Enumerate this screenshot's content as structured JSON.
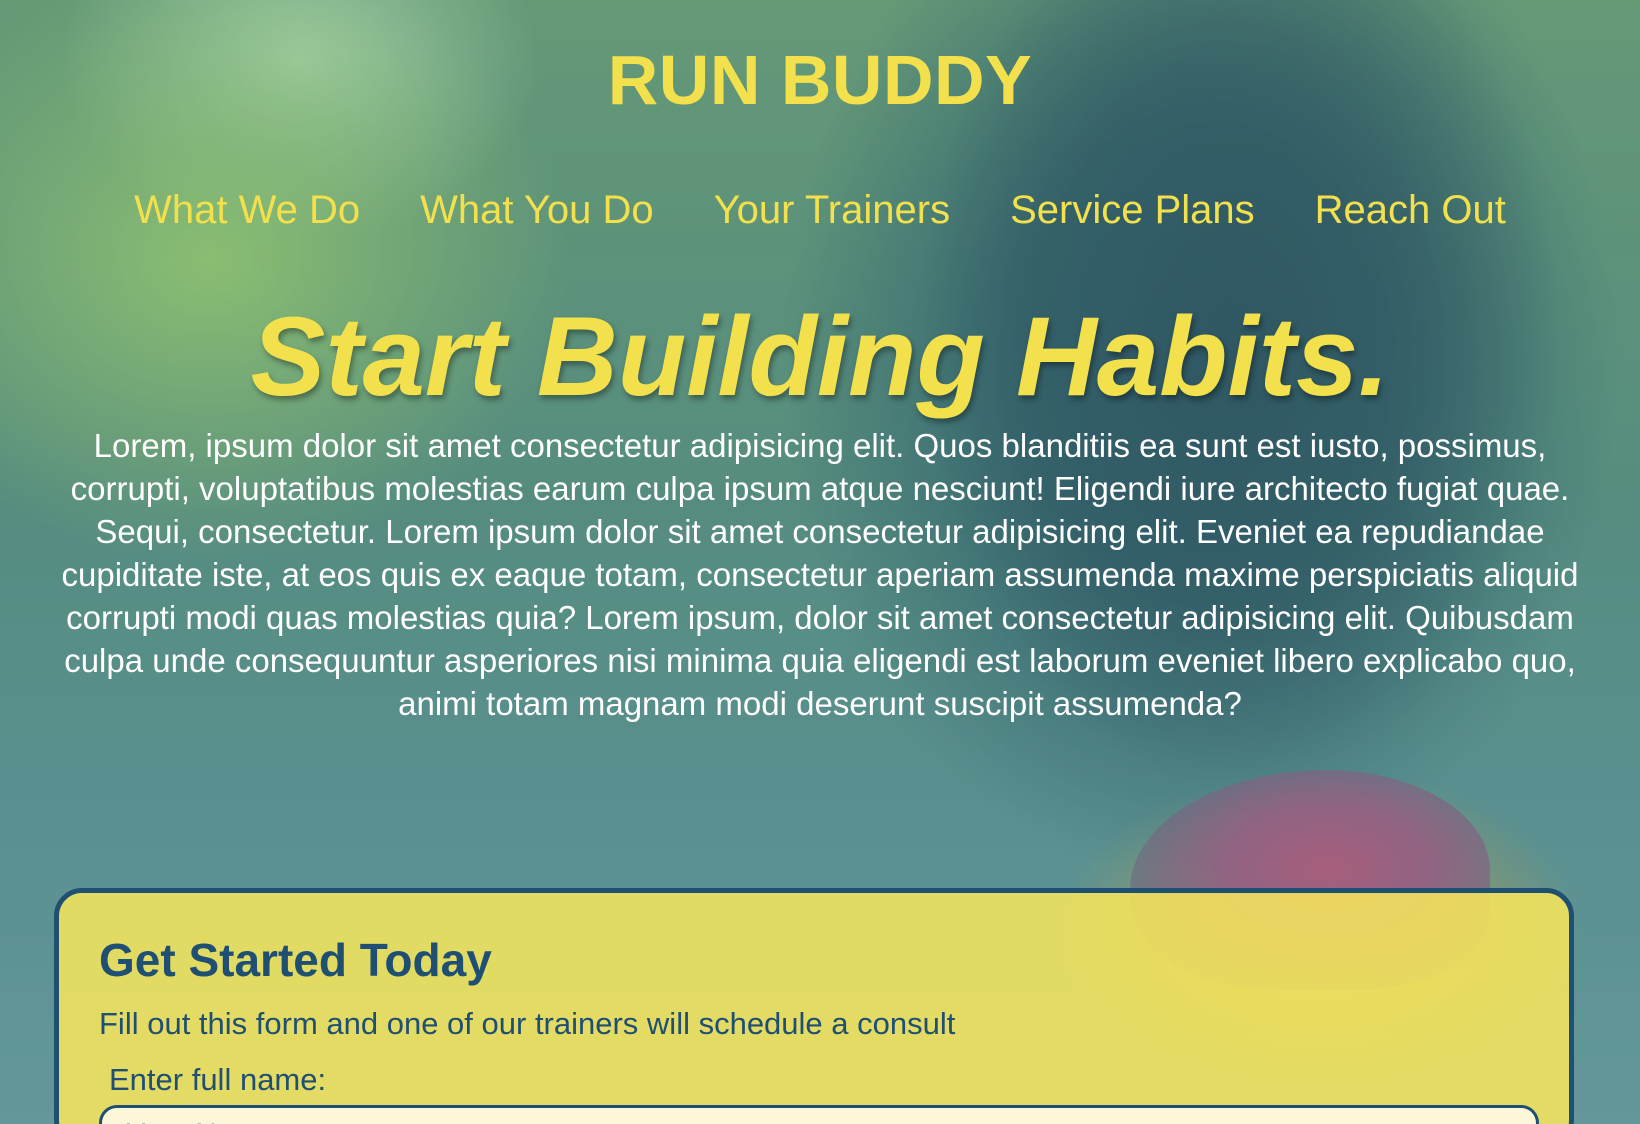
{
  "header": {
    "logo": "RUN BUDDY",
    "nav": [
      {
        "label": "What We Do"
      },
      {
        "label": "What You Do"
      },
      {
        "label": "Your Trainers"
      },
      {
        "label": "Service Plans"
      },
      {
        "label": "Reach Out"
      }
    ]
  },
  "hero": {
    "title": "Start Building Habits.",
    "body": "Lorem, ipsum dolor sit amet consectetur adipisicing elit. Quos blanditiis ea sunt est iusto, possimus, corrupti, voluptatibus molestias earum culpa ipsum atque nesciunt! Eligendi iure architecto fugiat quae. Sequi, consectetur. Lorem ipsum dolor sit amet consectetur adipisicing elit. Eveniet ea repudiandae cupiditate iste, at eos quis ex eaque totam, consectetur aperiam assumenda maxime perspiciatis aliquid corrupti modi quas molestias quia? Lorem ipsum, dolor sit amet consectetur adipisicing elit. Quibusdam culpa unde consequuntur asperiores nisi minima quia eligendi est laborum eveniet libero explicabo quo, animi totam magnam modi deserunt suscipit assumenda?"
  },
  "form": {
    "title": "Get Started Today",
    "subtitle": "Fill out this form and one of our trainers will schedule a consult",
    "name_label": "Enter full name:",
    "name_placeholder": "Your Name"
  },
  "colors": {
    "accent_yellow": "#f3e04d",
    "brand_navy": "#1f4f72"
  }
}
